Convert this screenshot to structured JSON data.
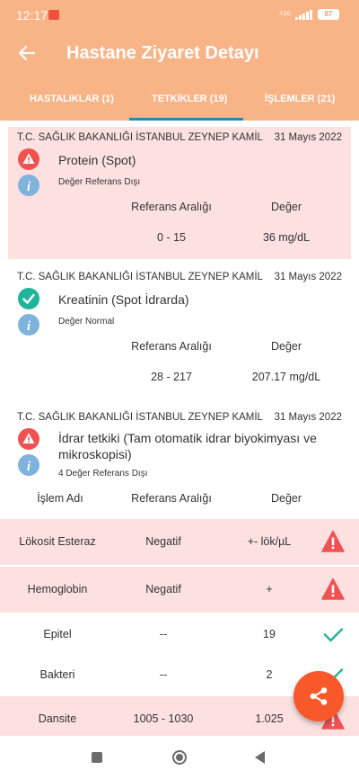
{
  "status_bar": {
    "time": "12:17",
    "network": "4.5G",
    "battery": "87"
  },
  "header": {
    "title": "Hastane Ziyaret Detayı"
  },
  "tabs": [
    {
      "label": "HASTALIKLAR (1)"
    },
    {
      "label": "TETKİKLER (19)"
    },
    {
      "label": "İŞLEMLER (21)"
    }
  ],
  "cards": [
    {
      "hospital": "T.C. SAĞLIK BAKANLIĞI İSTANBUL ZEYNEP KAMİL",
      "date": "31 Mayıs 2022",
      "test_name": "Protein (Spot)",
      "status_text": "Değer Referans Dışı",
      "ref_header": "Referans Aralığı",
      "value_header": "Değer",
      "ref_value": "0 - 15",
      "value": "36 mg/dL"
    },
    {
      "hospital": "T.C. SAĞLIK BAKANLIĞI İSTANBUL ZEYNEP KAMİL",
      "date": "31 Mayıs 2022",
      "test_name": "Kreatinin (Spot İdrarda)",
      "status_text": "Değer Normal",
      "ref_header": "Referans Aralığı",
      "value_header": "Değer",
      "ref_value": "28 - 217",
      "value": "207.17 mg/dL"
    },
    {
      "hospital": "T.C. SAĞLIK BAKANLIĞI İSTANBUL ZEYNEP KAMİL",
      "date": "31 Mayıs 2022",
      "test_name_line1": "İdrar tetkiki (Tam otomatik idrar biyokimyası ve",
      "test_name_line2": "mikroskopisi)",
      "status_text": "4 Değer Referans Dışı",
      "col_name": "İşlem Adı",
      "ref_header": "Referans Aralığı",
      "value_header": "Değer"
    }
  ],
  "sub_rows": [
    {
      "name": "Lökosit Esteraz",
      "ref": "Negatif",
      "value": "+- lök/µL",
      "abnormal": true
    },
    {
      "name": "Hemoglobin",
      "ref": "Negatif",
      "value": "+",
      "abnormal": true
    },
    {
      "name": "Epitel",
      "ref": "--",
      "value": "19",
      "abnormal": false
    },
    {
      "name": "Bakteri",
      "ref": "--",
      "value": "2",
      "abnormal": false
    },
    {
      "name": "Dansite",
      "ref": "1005 - 1030",
      "value": "1.025",
      "abnormal": true
    }
  ],
  "colors": {
    "header": "#f8b487",
    "abnormal_bg": "#fde1e1",
    "warning": "#f05252",
    "ok": "#20b49a",
    "info": "#7fb2dc",
    "fab": "#f9592a",
    "tab_indicator": "#1f87c9"
  }
}
